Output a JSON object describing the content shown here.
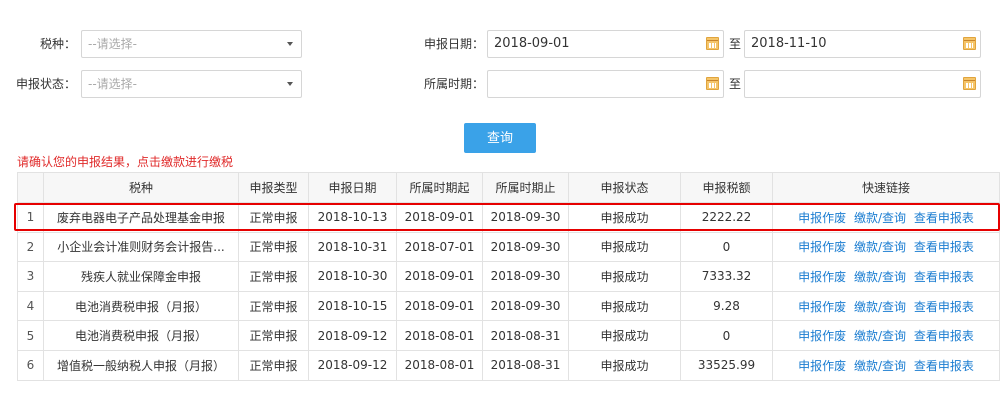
{
  "filters": {
    "tax_type_label": "税种：",
    "tax_type_placeholder": "--请选择-",
    "declare_date_label": "申报日期：",
    "declare_date_from": "2018-09-01",
    "to_label": "至",
    "declare_date_to": "2018-11-10",
    "status_label": "申报状态：",
    "status_placeholder": "--请选择-",
    "period_label": "所属时期：",
    "period_from": "",
    "period_to": ""
  },
  "query_button": "查询",
  "notice": "请确认您的申报结果，点击缴款进行缴税",
  "table": {
    "headers": [
      "",
      "税种",
      "申报类型",
      "申报日期",
      "所属时期起",
      "所属时期止",
      "申报状态",
      "申报税额",
      "快速链接"
    ],
    "rows": [
      {
        "idx": "1",
        "tax": "废弃电器电子产品处理基金申报",
        "type": "正常申报",
        "date": "2018-10-13",
        "start": "2018-09-01",
        "end": "2018-09-30",
        "status": "申报成功",
        "amount": "2222.22"
      },
      {
        "idx": "2",
        "tax": "小企业会计准则财务会计报告...",
        "type": "正常申报",
        "date": "2018-10-31",
        "start": "2018-07-01",
        "end": "2018-09-30",
        "status": "申报成功",
        "amount": "0"
      },
      {
        "idx": "3",
        "tax": "残疾人就业保障金申报",
        "type": "正常申报",
        "date": "2018-10-30",
        "start": "2018-09-01",
        "end": "2018-09-30",
        "status": "申报成功",
        "amount": "7333.32"
      },
      {
        "idx": "4",
        "tax": "电池消费税申报（月报）",
        "type": "正常申报",
        "date": "2018-10-15",
        "start": "2018-09-01",
        "end": "2018-09-30",
        "status": "申报成功",
        "amount": "9.28"
      },
      {
        "idx": "5",
        "tax": "电池消费税申报（月报）",
        "type": "正常申报",
        "date": "2018-09-12",
        "start": "2018-08-01",
        "end": "2018-08-31",
        "status": "申报成功",
        "amount": "0"
      },
      {
        "idx": "6",
        "tax": "增值税一般纳税人申报（月报）",
        "type": "正常申报",
        "date": "2018-09-12",
        "start": "2018-08-01",
        "end": "2018-08-31",
        "status": "申报成功",
        "amount": "33525.99"
      }
    ],
    "links": {
      "void": "申报作废",
      "pay": "缴款/查询",
      "view": "查看申报表"
    }
  },
  "icons": {
    "calendar": "calendar-icon",
    "dropdown": "chevron-down-icon"
  },
  "colors": {
    "accent": "#3aa2e8",
    "link": "#1b7dd1",
    "notice": "#e02a2a",
    "highlight": "#e60000"
  }
}
